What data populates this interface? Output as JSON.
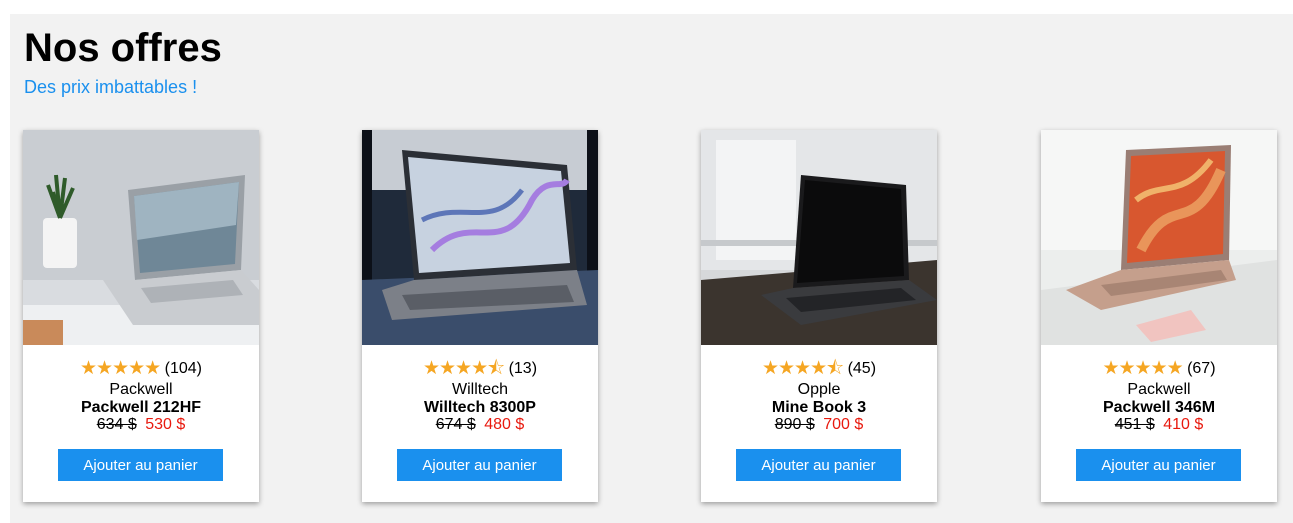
{
  "header": {
    "title": "Nos offres",
    "subtitle": "Des prix imbattables !"
  },
  "colors": {
    "accent": "#1a90ee",
    "sale_price": "#e8190e",
    "star": "#f5a623",
    "panel_bg": "#f2f2f2"
  },
  "products": [
    {
      "stars": "★★★★★",
      "rating": 5,
      "reviews": "(104)",
      "brand": "Packwell",
      "model": "Packwell 212HF",
      "old_price": "634 $",
      "new_price": "530 $",
      "button": "Ajouter au panier"
    },
    {
      "stars": "★★★★⯪",
      "rating": 4.5,
      "reviews": "(13)",
      "brand": "Willtech",
      "model": "Willtech 8300P",
      "old_price": "674 $",
      "new_price": "480 $",
      "button": "Ajouter au panier"
    },
    {
      "stars": "★★★★⯪",
      "rating": 4.5,
      "reviews": "(45)",
      "brand": "Opple",
      "model": "Mine Book 3",
      "old_price": "890 $",
      "new_price": "700 $",
      "button": "Ajouter au panier"
    },
    {
      "stars": "★★★★★",
      "rating": 5,
      "reviews": "(67)",
      "brand": "Packwell",
      "model": "Packwell 346M",
      "old_price": "451 $",
      "new_price": "410 $",
      "button": "Ajouter au panier"
    }
  ]
}
